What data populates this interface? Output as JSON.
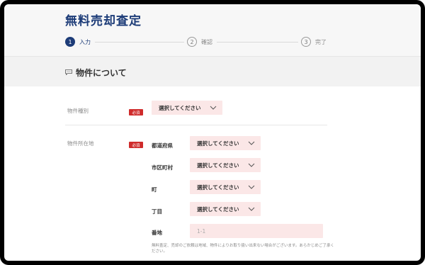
{
  "header": {
    "title": "無料売却査定",
    "steps": [
      {
        "num": "1",
        "label": "入力",
        "active": true
      },
      {
        "num": "2",
        "label": "確認",
        "active": false
      },
      {
        "num": "3",
        "label": "完了",
        "active": false
      }
    ]
  },
  "section": {
    "title": "物件について",
    "icon": "chat-bubble-icon"
  },
  "fields": {
    "property_type": {
      "label": "物件種別",
      "required": "必須",
      "select_value": "選択してください"
    },
    "location": {
      "label": "物件所在地",
      "required": "必須",
      "prefecture": {
        "label": "都道府県",
        "select_value": "選択してください"
      },
      "city": {
        "label": "市区町村",
        "select_value": "選択してください"
      },
      "town": {
        "label": "町",
        "select_value": "選択してください"
      },
      "chome": {
        "label": "丁目",
        "select_value": "選択してください"
      },
      "banchi": {
        "label": "番地",
        "placeholder": "1-1"
      }
    }
  },
  "note": "無料査定、売却のご依頼は地域、物件によりお取り扱い出来ない場合がございます。あらかじめご了承ください。",
  "colors": {
    "brand": "#1d3c78",
    "required_badge": "#cf2b2b",
    "select_bg": "#fbe7e7"
  }
}
